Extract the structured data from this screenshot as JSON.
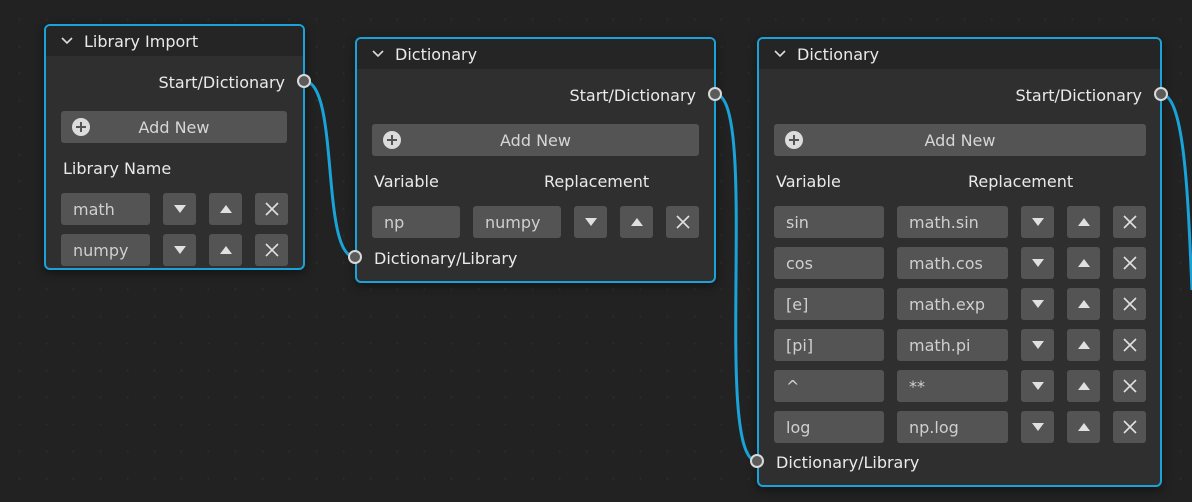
{
  "colors": {
    "accent": "#19a3d8",
    "node_bg": "#2f2f2f",
    "header_bg": "#252525",
    "widget_bg": "#545454"
  },
  "nodes": {
    "library_import": {
      "title": "Library Import",
      "output_socket": "Start/Dictionary",
      "add_new": "Add New",
      "column_header": "Library Name",
      "rows": [
        "math",
        "numpy"
      ]
    },
    "dictionary1": {
      "title": "Dictionary",
      "output_socket": "Start/Dictionary",
      "add_new": "Add New",
      "col_variable": "Variable",
      "col_replacement": "Replacement",
      "rows": [
        {
          "variable": "np",
          "replacement": "numpy"
        }
      ],
      "input_socket": "Dictionary/Library"
    },
    "dictionary2": {
      "title": "Dictionary",
      "output_socket": "Start/Dictionary",
      "add_new": "Add New",
      "col_variable": "Variable",
      "col_replacement": "Replacement",
      "rows": [
        {
          "variable": "sin",
          "replacement": "math.sin"
        },
        {
          "variable": "cos",
          "replacement": "math.cos"
        },
        {
          "variable": "[e]",
          "replacement": "math.exp"
        },
        {
          "variable": "[pi]",
          "replacement": "math.pi"
        },
        {
          "variable": "^",
          "replacement": "**"
        },
        {
          "variable": "log",
          "replacement": "np.log"
        }
      ],
      "input_socket": "Dictionary/Library"
    }
  },
  "icons": {
    "collapse": "chevron-down-icon",
    "add": "plus-circle-icon",
    "move_down": "triangle-down-icon",
    "move_up": "triangle-up-icon",
    "remove": "x-icon"
  }
}
